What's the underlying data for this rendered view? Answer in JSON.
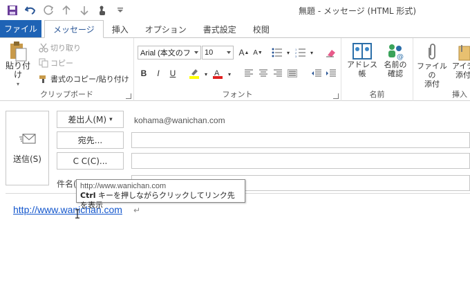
{
  "window": {
    "title": "無題 - メッセージ (HTML 形式)"
  },
  "qat": {
    "items": [
      "save-icon",
      "undo-icon",
      "redo-icon",
      "up-icon",
      "down-icon",
      "touch-icon",
      "customize-icon"
    ]
  },
  "tabs": {
    "file": "ファイル",
    "items": [
      "メッセージ",
      "挿入",
      "オプション",
      "書式設定",
      "校閲"
    ],
    "active_index": 0
  },
  "ribbon": {
    "clipboard": {
      "label": "クリップボード",
      "paste": "貼り付け",
      "cut": "切り取り",
      "copy": "コピー",
      "format_painter": "書式のコピー/貼り付け"
    },
    "font": {
      "label": "フォント",
      "font_name": "Arial (本文のフ",
      "font_size": "10",
      "bold": "B",
      "italic": "I",
      "underline": "U"
    },
    "names": {
      "label": "名前",
      "address_book": "アドレス帳",
      "check_names_line1": "名前の",
      "check_names_line2": "確認"
    },
    "insert": {
      "label": "挿入",
      "attach_file_line1": "ファイルの",
      "attach_file_line2": "添付",
      "attach_item_line1": "アイテ",
      "attach_item_line2": "添付"
    }
  },
  "compose": {
    "send": "送信(S)",
    "from_button": "差出人(M)",
    "from_value": "kohama@wanichan.com",
    "to_button": "宛先...",
    "cc_button": "C C(C)...",
    "subject_label": "件名(",
    "body_link": "http://www.wanichan.com",
    "tooltip_url": "http://www.wanichan.com",
    "tooltip_key": "Ctrl",
    "tooltip_hint": " キーを押しながらクリックしてリンク先を表示"
  },
  "colors": {
    "accent": "#1e63b5",
    "link": "#1155cc",
    "highlight": "#ffff00",
    "font_color": "#e02020"
  }
}
